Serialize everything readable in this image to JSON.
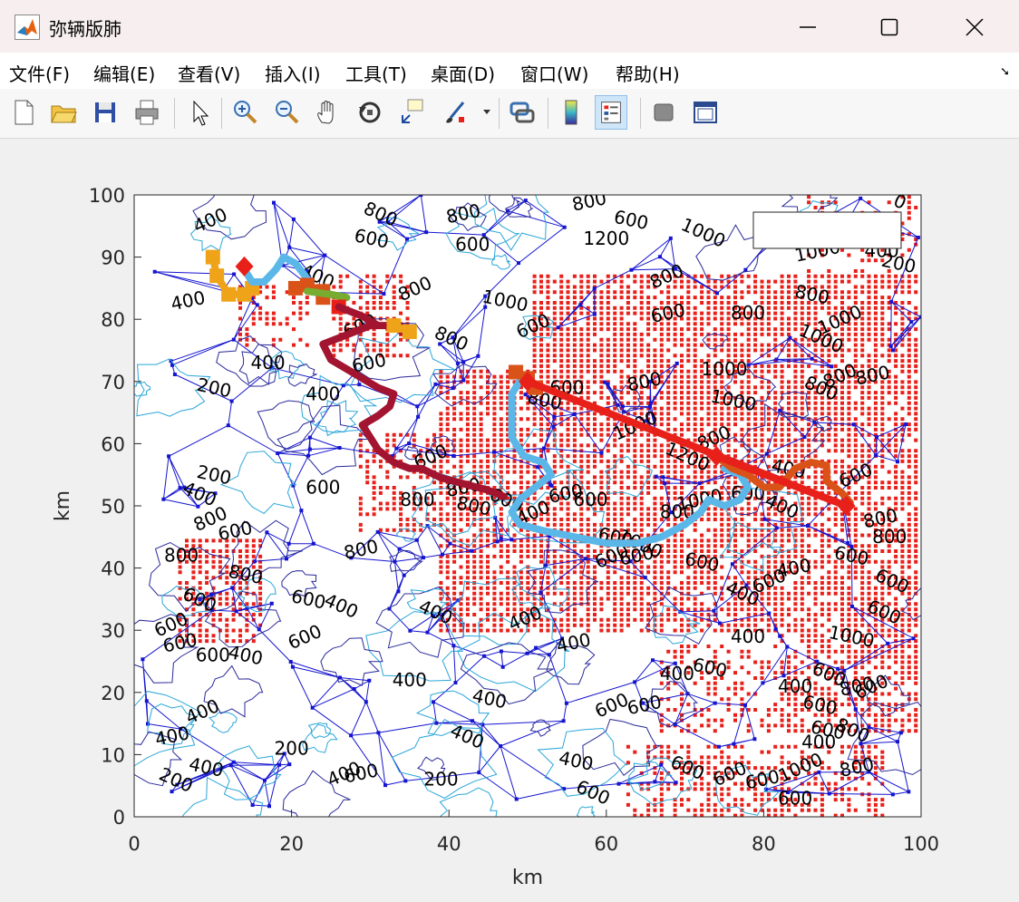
{
  "window": {
    "title": "弥辆版肺"
  },
  "menu": [
    "文件(F)",
    "编辑(E)",
    "查看(V)",
    "插入(I)",
    "工具(T)",
    "桌面(D)",
    "窗口(W)",
    "帮助(H)"
  ],
  "toolbar_icons": [
    "new-file-icon",
    "open-folder-icon",
    "save-icon",
    "print-icon",
    "pointer-icon",
    "zoom-in-icon",
    "zoom-out-icon",
    "pan-hand-icon",
    "rotate-3d-icon",
    "data-cursor-icon",
    "brush-icon",
    "link-plot-icon",
    "colorbar-icon",
    "legend-icon",
    "hide-plot-tools-icon",
    "show-plot-tools-icon"
  ],
  "colors": {
    "obstacle": "#e8201a",
    "mesh": "#1515d0",
    "contour_dark": "#2a2a9a",
    "contour_light": "#2aa6d8"
  },
  "chart_data": {
    "type": "line",
    "title": "",
    "xlabel": "km",
    "ylabel": "km",
    "xlim": [
      0,
      100
    ],
    "ylim": [
      0,
      100
    ],
    "xticks": [
      "0",
      "20",
      "40",
      "60",
      "80",
      "100"
    ],
    "yticks": [
      "0",
      "10",
      "20",
      "30",
      "40",
      "50",
      "60",
      "70",
      "80",
      "90",
      "100"
    ],
    "legend_placement": "top-right",
    "contour_labels": [
      {
        "x": 10,
        "y": 95,
        "t": "400"
      },
      {
        "x": 7,
        "y": 82,
        "t": "400"
      },
      {
        "x": 17,
        "y": 72,
        "t": "400"
      },
      {
        "x": 10,
        "y": 68,
        "t": "200"
      },
      {
        "x": 23,
        "y": 86,
        "t": "400"
      },
      {
        "x": 29,
        "y": 78,
        "t": "600"
      },
      {
        "x": 30,
        "y": 72,
        "t": "600"
      },
      {
        "x": 24,
        "y": 67,
        "t": "400"
      },
      {
        "x": 30,
        "y": 92,
        "t": "600"
      },
      {
        "x": 31,
        "y": 96,
        "t": "800"
      },
      {
        "x": 36,
        "y": 84,
        "t": "800"
      },
      {
        "x": 42,
        "y": 96,
        "t": "800"
      },
      {
        "x": 43,
        "y": 91,
        "t": "600"
      },
      {
        "x": 47,
        "y": 82,
        "t": "1000"
      },
      {
        "x": 40,
        "y": 76,
        "t": "800"
      },
      {
        "x": 51,
        "y": 78,
        "t": "600"
      },
      {
        "x": 58,
        "y": 98,
        "t": "800"
      },
      {
        "x": 60,
        "y": 92,
        "t": "1200"
      },
      {
        "x": 63,
        "y": 95,
        "t": "600"
      },
      {
        "x": 72,
        "y": 93,
        "t": "1000"
      },
      {
        "x": 68,
        "y": 86,
        "t": "800"
      },
      {
        "x": 68,
        "y": 80,
        "t": "600"
      },
      {
        "x": 78,
        "y": 80,
        "t": "800"
      },
      {
        "x": 86,
        "y": 83,
        "t": "800"
      },
      {
        "x": 87,
        "y": 76,
        "t": "1000"
      },
      {
        "x": 90,
        "y": 79,
        "t": "1000"
      },
      {
        "x": 87,
        "y": 90,
        "t": "1000"
      },
      {
        "x": 95,
        "y": 90,
        "t": "400"
      },
      {
        "x": 97,
        "y": 88,
        "t": "200"
      },
      {
        "x": 97,
        "y": 98,
        "t": "0"
      },
      {
        "x": 90,
        "y": 70,
        "t": "800"
      },
      {
        "x": 94,
        "y": 70,
        "t": "800"
      },
      {
        "x": 75,
        "y": 71,
        "t": "1000"
      },
      {
        "x": 76,
        "y": 66,
        "t": "1000"
      },
      {
        "x": 87,
        "y": 68,
        "t": "800"
      },
      {
        "x": 64,
        "y": 62,
        "t": "1000"
      },
      {
        "x": 65,
        "y": 69,
        "t": "800"
      },
      {
        "x": 55,
        "y": 68,
        "t": "600"
      },
      {
        "x": 52,
        "y": 66,
        "t": "800"
      },
      {
        "x": 70,
        "y": 57,
        "t": "1200"
      },
      {
        "x": 74,
        "y": 60,
        "t": "800"
      },
      {
        "x": 72,
        "y": 50,
        "t": "1000"
      },
      {
        "x": 78,
        "y": 51,
        "t": "600"
      },
      {
        "x": 83,
        "y": 55,
        "t": "400"
      },
      {
        "x": 82,
        "y": 49,
        "t": "400"
      },
      {
        "x": 92,
        "y": 54,
        "t": "600"
      },
      {
        "x": 95,
        "y": 47,
        "t": "800"
      },
      {
        "x": 96,
        "y": 44,
        "t": "800"
      },
      {
        "x": 91,
        "y": 41,
        "t": "600"
      },
      {
        "x": 96,
        "y": 37,
        "t": "600"
      },
      {
        "x": 38,
        "y": 57,
        "t": "600"
      },
      {
        "x": 42,
        "y": 52,
        "t": "800"
      },
      {
        "x": 36,
        "y": 50,
        "t": "800"
      },
      {
        "x": 43,
        "y": 49,
        "t": "800"
      },
      {
        "x": 47,
        "y": 50,
        "t": "600"
      },
      {
        "x": 51,
        "y": 48,
        "t": "400"
      },
      {
        "x": 55,
        "y": 51,
        "t": "600"
      },
      {
        "x": 58,
        "y": 50,
        "t": "600"
      },
      {
        "x": 61,
        "y": 44,
        "t": "600"
      },
      {
        "x": 64,
        "y": 43,
        "t": "1000"
      },
      {
        "x": 61,
        "y": 41,
        "t": "600"
      },
      {
        "x": 64,
        "y": 41,
        "t": "600"
      },
      {
        "x": 69,
        "y": 48,
        "t": "800"
      },
      {
        "x": 72,
        "y": 40,
        "t": "600"
      },
      {
        "x": 77,
        "y": 35,
        "t": "400"
      },
      {
        "x": 81,
        "y": 37,
        "t": "600"
      },
      {
        "x": 84,
        "y": 39,
        "t": "400"
      },
      {
        "x": 78,
        "y": 28,
        "t": "400"
      },
      {
        "x": 10,
        "y": 54,
        "t": "200"
      },
      {
        "x": 8,
        "y": 51,
        "t": "400"
      },
      {
        "x": 10,
        "y": 47,
        "t": "800"
      },
      {
        "x": 13,
        "y": 45,
        "t": "600"
      },
      {
        "x": 6,
        "y": 41,
        "t": "800"
      },
      {
        "x": 14,
        "y": 38,
        "t": "800"
      },
      {
        "x": 8,
        "y": 34,
        "t": "600"
      },
      {
        "x": 5,
        "y": 30,
        "t": "600"
      },
      {
        "x": 6,
        "y": 27,
        "t": "600"
      },
      {
        "x": 10,
        "y": 25,
        "t": "600"
      },
      {
        "x": 22,
        "y": 34,
        "t": "600"
      },
      {
        "x": 26,
        "y": 33,
        "t": "400"
      },
      {
        "x": 22,
        "y": 28,
        "t": "600"
      },
      {
        "x": 29,
        "y": 42,
        "t": "800"
      },
      {
        "x": 24,
        "y": 52,
        "t": "600"
      },
      {
        "x": 14,
        "y": 25,
        "t": "400"
      },
      {
        "x": 38,
        "y": 32,
        "t": "400"
      },
      {
        "x": 50,
        "y": 31,
        "t": "400"
      },
      {
        "x": 56,
        "y": 27,
        "t": "400"
      },
      {
        "x": 35,
        "y": 21,
        "t": "400"
      },
      {
        "x": 45,
        "y": 18,
        "t": "400"
      },
      {
        "x": 42,
        "y": 12,
        "t": "400"
      },
      {
        "x": 9,
        "y": 16,
        "t": "400"
      },
      {
        "x": 5,
        "y": 12,
        "t": "400"
      },
      {
        "x": 20,
        "y": 10,
        "t": "200"
      },
      {
        "x": 9,
        "y": 7,
        "t": "400"
      },
      {
        "x": 5,
        "y": 5,
        "t": "200"
      },
      {
        "x": 27,
        "y": 6,
        "t": "400"
      },
      {
        "x": 29,
        "y": 6,
        "t": "600"
      },
      {
        "x": 39,
        "y": 5,
        "t": "200"
      },
      {
        "x": 56,
        "y": 8,
        "t": "400"
      },
      {
        "x": 58,
        "y": 3,
        "t": "600"
      },
      {
        "x": 61,
        "y": 17,
        "t": "600"
      },
      {
        "x": 65,
        "y": 17,
        "t": "600"
      },
      {
        "x": 69,
        "y": 22,
        "t": "400"
      },
      {
        "x": 73,
        "y": 23,
        "t": "600"
      },
      {
        "x": 70,
        "y": 7,
        "t": "600"
      },
      {
        "x": 76,
        "y": 6,
        "t": "600"
      },
      {
        "x": 80,
        "y": 5,
        "t": "600"
      },
      {
        "x": 84,
        "y": 20,
        "t": "400"
      },
      {
        "x": 87,
        "y": 17,
        "t": "600"
      },
      {
        "x": 88,
        "y": 22,
        "t": "600"
      },
      {
        "x": 94,
        "y": 20,
        "t": "600"
      },
      {
        "x": 92,
        "y": 20,
        "t": "800"
      },
      {
        "x": 87,
        "y": 11,
        "t": "400"
      },
      {
        "x": 88,
        "y": 13,
        "t": "600"
      },
      {
        "x": 91,
        "y": 13,
        "t": "800"
      },
      {
        "x": 85,
        "y": 7,
        "t": "1000"
      },
      {
        "x": 92,
        "y": 7,
        "t": "800"
      },
      {
        "x": 84,
        "y": 2,
        "t": "600"
      },
      {
        "x": 91,
        "y": 28,
        "t": "1000"
      },
      {
        "x": 95,
        "y": 32,
        "t": "600"
      }
    ],
    "series": [
      {
        "color": "#eea319",
        "marker": "square",
        "values": [
          [
            10,
            90
          ],
          [
            10.5,
            87
          ],
          [
            12,
            84
          ],
          [
            14,
            84
          ],
          [
            15,
            85
          ]
        ]
      },
      {
        "color": "#5ab7e8",
        "marker": "none",
        "values": [
          [
            14,
            88
          ],
          [
            15,
            86
          ],
          [
            16.5,
            86
          ],
          [
            18,
            88
          ],
          [
            19,
            90
          ],
          [
            20.5,
            89
          ],
          [
            22,
            86.5
          ]
        ]
      },
      {
        "color": "#e8201a",
        "marker": "diamond",
        "values": [
          [
            14,
            88.5
          ]
        ]
      },
      {
        "color": "#d95319",
        "marker": "square",
        "values": [
          [
            20.5,
            85
          ],
          [
            22,
            85.5
          ],
          [
            24,
            84.5
          ],
          [
            24,
            83.5
          ]
        ]
      },
      {
        "color": "#77ac30",
        "marker": "none",
        "values": [
          [
            22,
            84.5
          ],
          [
            25,
            84
          ],
          [
            27,
            83.5
          ]
        ]
      },
      {
        "color": "#e8201a",
        "marker": "square",
        "values": [
          [
            26,
            82
          ]
        ]
      },
      {
        "color": "#a2142f",
        "marker": "none",
        "values": [
          [
            26,
            82
          ],
          [
            29,
            80.5
          ],
          [
            31,
            79
          ],
          [
            33,
            79
          ],
          [
            35,
            78.5
          ],
          [
            34,
            78
          ],
          [
            33,
            79
          ],
          [
            30,
            79
          ],
          [
            26,
            77
          ],
          [
            24,
            76
          ],
          [
            25,
            73.5
          ],
          [
            27,
            72
          ],
          [
            29,
            70.5
          ],
          [
            31,
            69
          ],
          [
            33,
            68
          ],
          [
            32.5,
            66
          ],
          [
            31,
            64.5
          ],
          [
            29,
            63
          ],
          [
            30,
            61
          ],
          [
            31,
            59
          ],
          [
            33,
            57
          ],
          [
            35,
            56
          ],
          [
            36.5,
            56
          ],
          [
            39,
            54.5
          ],
          [
            42,
            53.5
          ],
          [
            45,
            52.5
          ],
          [
            47,
            51.5
          ]
        ]
      },
      {
        "color": "#eea319",
        "marker": "square",
        "values": [
          [
            33,
            79
          ],
          [
            35,
            78
          ]
        ]
      },
      {
        "color": "#5ab7e8",
        "marker": "none",
        "values": [
          [
            49.5,
            71
          ],
          [
            48,
            68
          ],
          [
            48,
            64
          ],
          [
            48,
            61
          ],
          [
            49.5,
            58
          ],
          [
            52,
            57
          ],
          [
            53,
            55
          ],
          [
            51,
            53
          ],
          [
            49,
            51
          ],
          [
            48,
            49
          ],
          [
            49,
            47
          ],
          [
            52,
            46
          ],
          [
            56,
            45
          ],
          [
            60,
            44
          ],
          [
            64,
            44
          ],
          [
            67,
            45
          ],
          [
            70,
            47
          ],
          [
            72,
            49
          ],
          [
            73,
            51
          ],
          [
            75,
            50
          ],
          [
            77,
            51
          ],
          [
            78,
            53
          ],
          [
            77,
            55
          ],
          [
            75,
            56
          ]
        ]
      },
      {
        "color": "#d95319",
        "marker": "square",
        "values": [
          [
            48.5,
            71.5
          ],
          [
            50,
            70.5
          ],
          [
            51,
            69
          ]
        ]
      },
      {
        "color": "#d95319",
        "marker": "none",
        "values": [
          [
            74,
            58
          ],
          [
            76,
            56
          ],
          [
            78,
            55
          ],
          [
            80,
            53
          ],
          [
            82,
            53
          ],
          [
            84,
            56
          ],
          [
            86,
            57
          ],
          [
            88,
            56.5
          ],
          [
            88,
            54
          ],
          [
            90,
            52
          ],
          [
            91,
            50.5
          ]
        ]
      },
      {
        "color": "#e8201a",
        "marker": "diamond",
        "values": [
          [
            74,
            58
          ],
          [
            90.5,
            50
          ],
          [
            50,
            70
          ]
        ]
      }
    ]
  }
}
